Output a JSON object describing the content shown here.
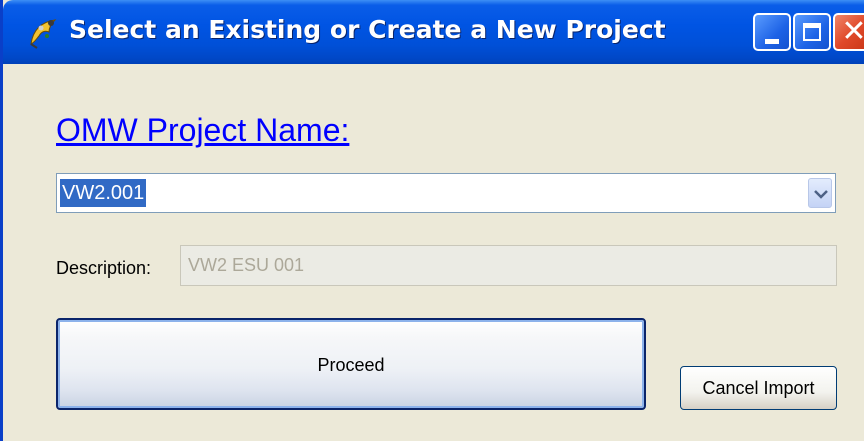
{
  "window": {
    "title": "Select an Existing or Create a New Project",
    "icon": "app-icon",
    "controls": [
      "minimize-icon",
      "maximize-icon",
      "close-icon"
    ],
    "colors": {
      "titlebar": "#0054e3",
      "background": "#ece9d8",
      "close_button": "#e0492a"
    }
  },
  "form": {
    "project_label": "OMW Project Name:",
    "project_value": "VW2.001",
    "description_label": "Description:",
    "description_value": "VW2 ESU 001",
    "link_color": "#0000ff",
    "selection_color": "#316ac5"
  },
  "buttons": {
    "proceed_label": "Proceed",
    "cancel_label": "Cancel Import"
  }
}
